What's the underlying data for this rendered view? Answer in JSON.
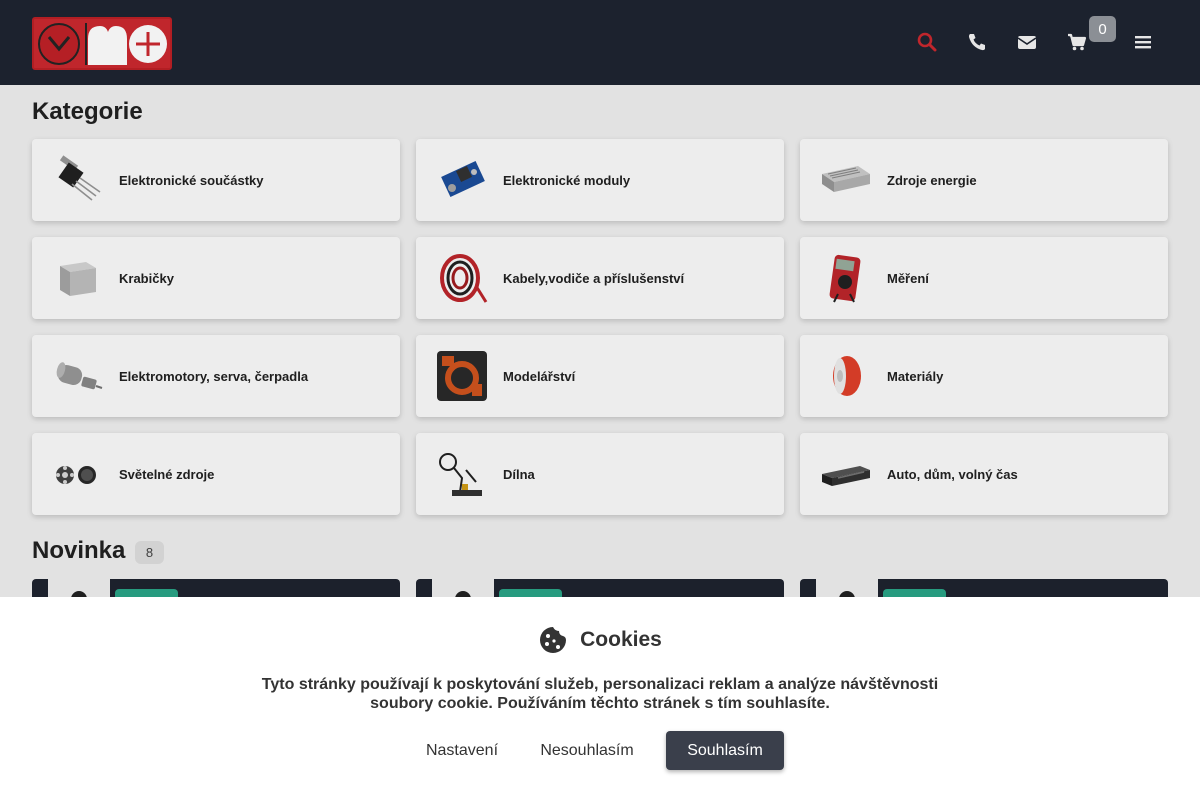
{
  "header": {
    "logo_icon": "mplus-logo",
    "cart_count": "0",
    "icons": [
      "search-icon",
      "phone-icon",
      "mail-icon",
      "cart-icon",
      "menu-icon"
    ],
    "colors": {
      "background": "#1c222e",
      "accent": "#c0262c"
    }
  },
  "categories": {
    "title": "Kategorie",
    "items": [
      {
        "label": "Elektronické součástky"
      },
      {
        "label": "Elektronické moduly"
      },
      {
        "label": "Zdroje energie"
      },
      {
        "label": "Krabičky"
      },
      {
        "label": "Kabely,vodiče a příslušenství"
      },
      {
        "label": "Měření"
      },
      {
        "label": "Elektromotory, serva, čerpadla"
      },
      {
        "label": "Modelářství"
      },
      {
        "label": "Materiály"
      },
      {
        "label": "Světelné zdroje"
      },
      {
        "label": "Dílna"
      },
      {
        "label": "Auto, dům, volný čas"
      }
    ]
  },
  "novinka": {
    "title": "Novinka",
    "count": "8"
  },
  "cookies": {
    "title": "Cookies",
    "text": "Tyto stránky používají k poskytování služeb, personalizaci reklam a analýze návštěvnosti soubory cookie. Používáním těchto stránek s tím souhlasíte.",
    "settings_label": "Nastavení",
    "decline_label": "Nesouhlasím",
    "accept_label": "Souhlasím"
  }
}
